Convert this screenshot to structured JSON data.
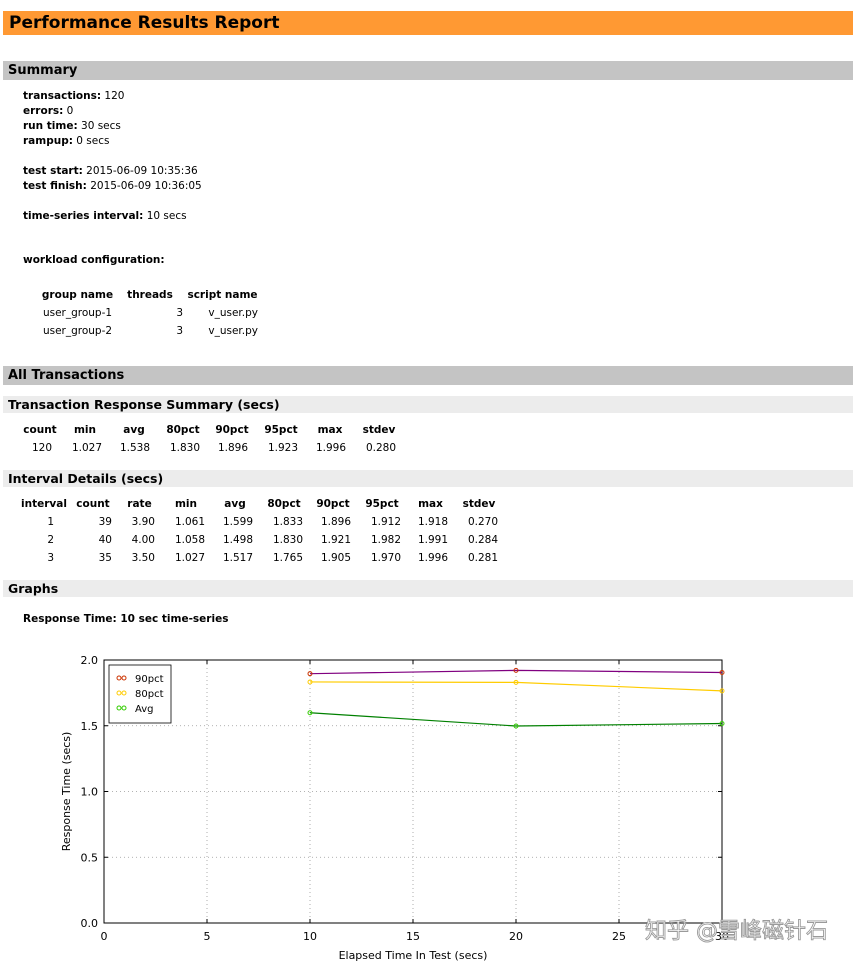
{
  "report": {
    "title": "Performance Results Report"
  },
  "summary": {
    "heading": "Summary",
    "transactions_label": "transactions:",
    "transactions": "120",
    "errors_label": "errors:",
    "errors": "0",
    "run_time_label": "run time:",
    "run_time": "30 secs",
    "rampup_label": "rampup:",
    "rampup": "0 secs",
    "test_start_label": "test start:",
    "test_start": "2015-06-09 10:35:36",
    "test_finish_label": "test finish:",
    "test_finish": "2015-06-09 10:36:05",
    "interval_label": "time-series interval:",
    "interval": "10 secs",
    "workload_label": "workload configuration:",
    "workload_headers": [
      "group name",
      "threads",
      "script name"
    ],
    "workload_rows": [
      [
        "user_group-1",
        "3",
        "v_user.py"
      ],
      [
        "user_group-2",
        "3",
        "v_user.py"
      ]
    ]
  },
  "all_transactions": {
    "heading": "All Transactions",
    "response_summary": {
      "heading": "Transaction Response Summary (secs)",
      "headers": [
        "count",
        "min",
        "avg",
        "80pct",
        "90pct",
        "95pct",
        "max",
        "stdev"
      ],
      "row": [
        "120",
        "1.027",
        "1.538",
        "1.830",
        "1.896",
        "1.923",
        "1.996",
        "0.280"
      ]
    },
    "interval_details": {
      "heading": "Interval Details (secs)",
      "headers": [
        "interval",
        "count",
        "rate",
        "min",
        "avg",
        "80pct",
        "90pct",
        "95pct",
        "max",
        "stdev"
      ],
      "rows": [
        [
          "1",
          "39",
          "3.90",
          "1.061",
          "1.599",
          "1.833",
          "1.896",
          "1.912",
          "1.918",
          "0.270"
        ],
        [
          "2",
          "40",
          "4.00",
          "1.058",
          "1.498",
          "1.830",
          "1.921",
          "1.982",
          "1.991",
          "0.284"
        ],
        [
          "3",
          "35",
          "3.50",
          "1.027",
          "1.517",
          "1.765",
          "1.905",
          "1.970",
          "1.996",
          "0.281"
        ]
      ]
    },
    "graphs": {
      "heading": "Graphs",
      "response_time_label": "Response Time: 10 sec time-series"
    }
  },
  "watermark": "知乎 @雪峰磁针石",
  "chart_data": {
    "type": "line",
    "title": "",
    "xlabel": "Elapsed Time In Test (secs)",
    "ylabel": "Response Time (secs)",
    "xlim": [
      0,
      30
    ],
    "ylim": [
      0,
      2.0
    ],
    "xticks": [
      0,
      5,
      10,
      15,
      20,
      25,
      30
    ],
    "yticks": [
      0.0,
      0.5,
      1.0,
      1.5,
      2.0
    ],
    "xtick_labels": [
      "0",
      "5",
      "10",
      "15",
      "20",
      "25",
      "30"
    ],
    "ytick_labels": [
      "0.0",
      "0.5",
      "1.0",
      "1.5",
      "2.0"
    ],
    "grid": true,
    "legend_position": "top-left",
    "x": [
      10,
      20,
      30
    ],
    "series": [
      {
        "name": "90pct",
        "values": [
          1.896,
          1.921,
          1.905
        ],
        "color": "#800080",
        "marker_color": "#cc3300"
      },
      {
        "name": "80pct",
        "values": [
          1.833,
          1.83,
          1.765
        ],
        "color": "#ffcc00",
        "marker_color": "#ffcc00"
      },
      {
        "name": "Avg",
        "values": [
          1.599,
          1.498,
          1.517
        ],
        "color": "#008000",
        "marker_color": "#33cc00"
      }
    ]
  }
}
